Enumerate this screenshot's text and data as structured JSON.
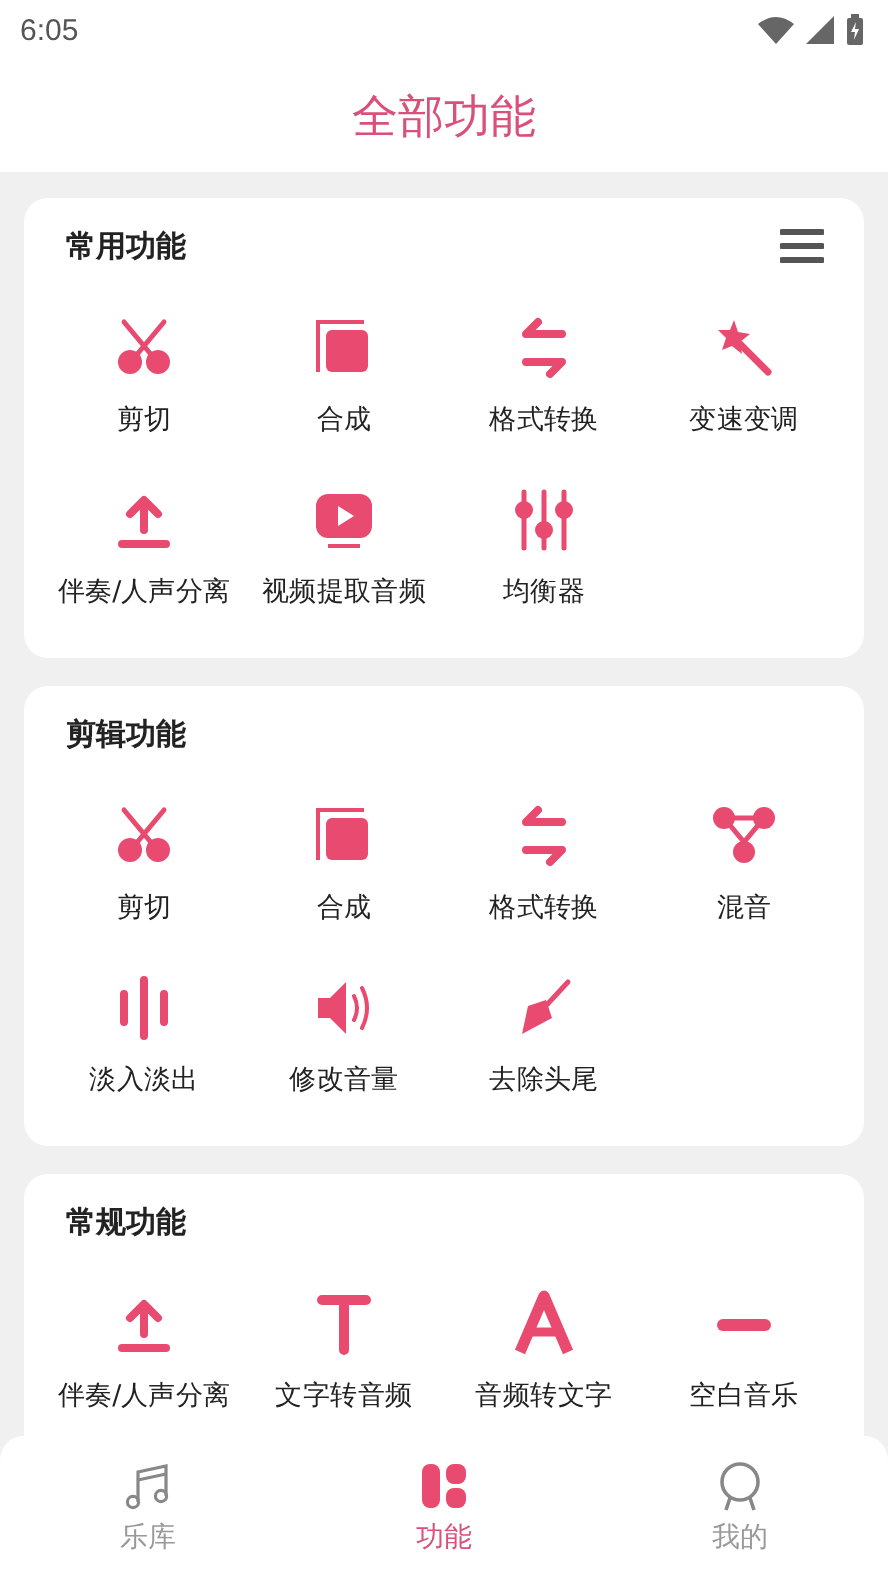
{
  "status_bar": {
    "time": "6:05"
  },
  "header": {
    "title": "全部功能"
  },
  "sections": [
    {
      "title": "常用功能",
      "menu_button": true,
      "items": [
        {
          "label": "剪切",
          "kind": "scissors"
        },
        {
          "label": "合成",
          "kind": "layers"
        },
        {
          "label": "格式转换",
          "kind": "swap"
        },
        {
          "label": "变速变调",
          "kind": "wand"
        },
        {
          "label": "伴奏/人声分离",
          "kind": "upload"
        },
        {
          "label": "视频提取音频",
          "kind": "play"
        },
        {
          "label": "均衡器",
          "kind": "sliders"
        }
      ]
    },
    {
      "title": "剪辑功能",
      "items": [
        {
          "label": "剪切",
          "kind": "scissors"
        },
        {
          "label": "合成",
          "kind": "layers"
        },
        {
          "label": "格式转换",
          "kind": "swap"
        },
        {
          "label": "混音",
          "kind": "merge"
        },
        {
          "label": "淡入淡出",
          "kind": "bars"
        },
        {
          "label": "修改音量",
          "kind": "volume"
        },
        {
          "label": "去除头尾",
          "kind": "trowel"
        }
      ]
    },
    {
      "title": "常规功能",
      "items": [
        {
          "label": "伴奏/人声分离",
          "kind": "upload"
        },
        {
          "label": "文字转音频",
          "kind": "letter-t"
        },
        {
          "label": "音频转文字",
          "kind": "letter-a"
        },
        {
          "label": "空白音乐",
          "kind": "dash"
        }
      ]
    }
  ],
  "tab_bar": [
    {
      "label": "乐库",
      "kind": "note",
      "selected": false
    },
    {
      "label": "功能",
      "kind": "grid",
      "selected": true
    },
    {
      "label": "我的",
      "kind": "ring",
      "selected": false
    }
  ]
}
